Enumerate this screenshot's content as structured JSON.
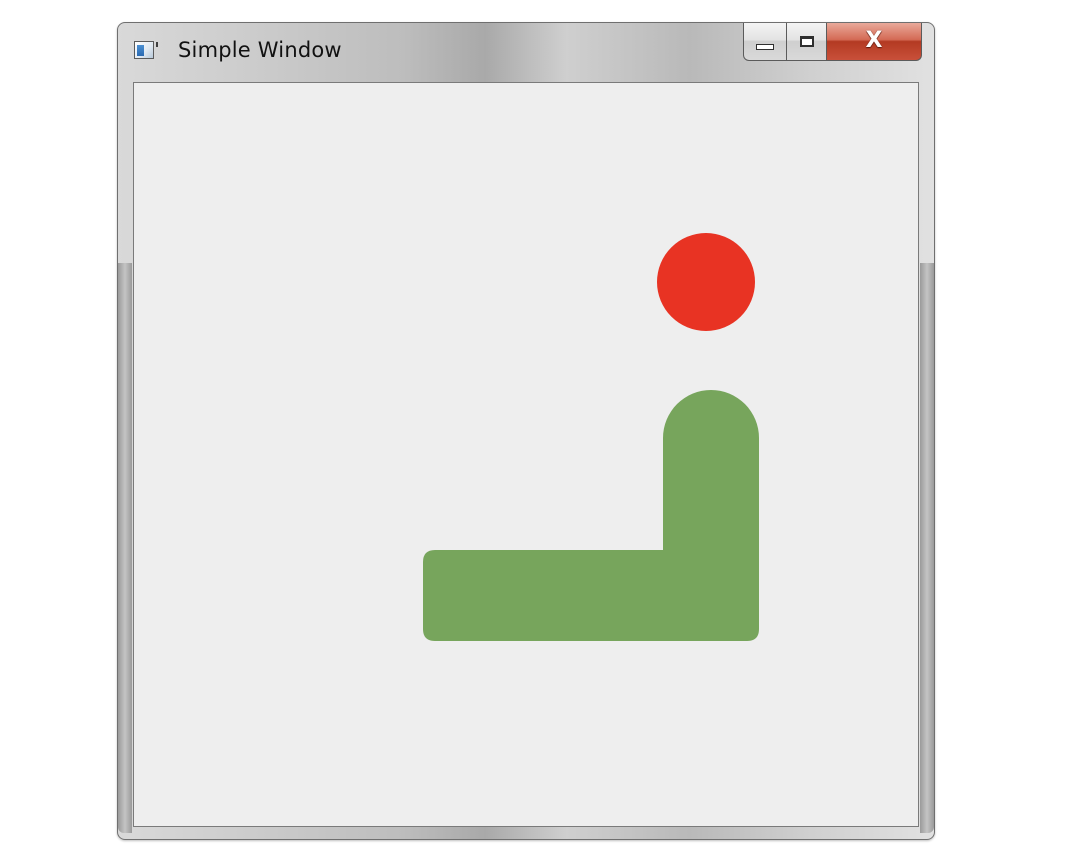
{
  "window": {
    "title": "Simple Window",
    "icon": "app-window-icon",
    "close_label": "X"
  },
  "canvas": {
    "background": "#eeeeee",
    "shapes": [
      {
        "name": "red-circle",
        "color": "#e83323"
      },
      {
        "name": "green-l-shape",
        "color": "#77a55c"
      }
    ]
  }
}
